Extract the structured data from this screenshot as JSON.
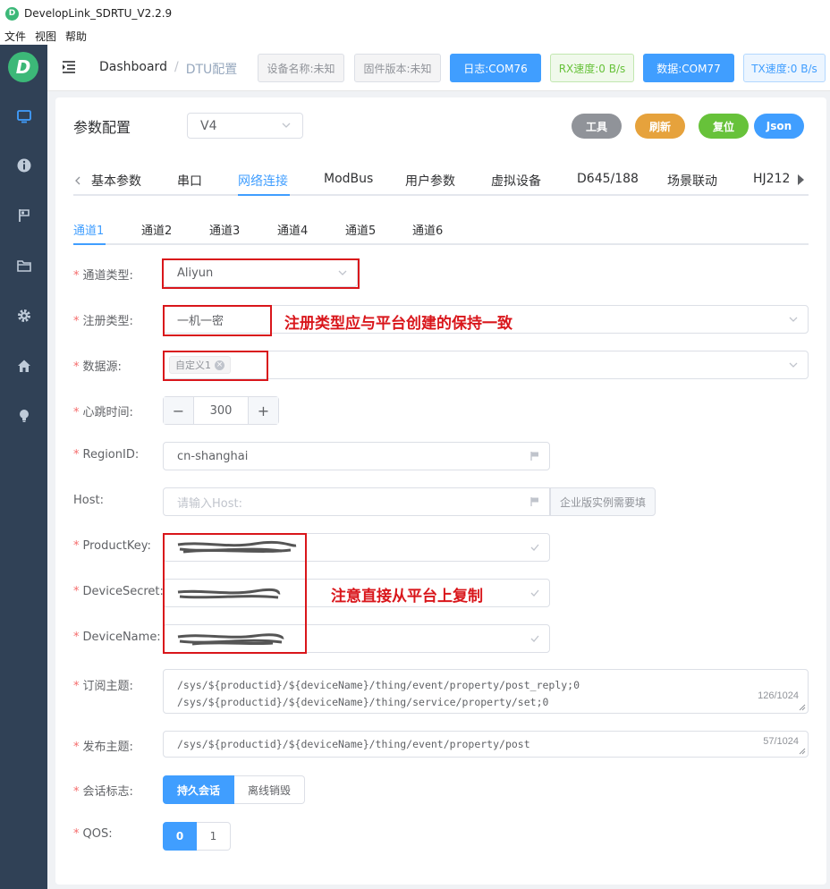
{
  "window": {
    "title": "DevelopLink_SDRTU_V2.2.9",
    "logo_letter": "D"
  },
  "menu": [
    "文件",
    "视图",
    "帮助"
  ],
  "sidebar": {
    "logo_letter": "D",
    "items": [
      {
        "name": "monitor-icon"
      },
      {
        "name": "info-icon"
      },
      {
        "name": "flag-icon"
      },
      {
        "name": "folder-icon"
      },
      {
        "name": "gear-icon"
      },
      {
        "name": "home-icon"
      },
      {
        "name": "bulb-icon"
      }
    ]
  },
  "header": {
    "breadcrumb_home": "Dashboard",
    "breadcrumb_sep": "/",
    "breadcrumb_current": "DTU配置",
    "buttons": {
      "device_name": "设备名称:未知",
      "firmware": "固件版本:未知",
      "log_port": "日志:COM76",
      "rx_speed": "RX速度:0 B/s",
      "data_port": "数据:COM77",
      "tx_speed": "TX速度:0 B/s"
    }
  },
  "card": {
    "title": "参数配置",
    "version_select": "V4",
    "actions": {
      "tool": "工具",
      "refresh": "刷新",
      "reset": "复位",
      "json": "Json"
    }
  },
  "tabs_main": [
    "基本参数",
    "串口",
    "网络连接",
    "ModBus",
    "用户参数",
    "虚拟设备",
    "D645/188",
    "场景联动",
    "HJ212"
  ],
  "tabs_main_active": "网络连接",
  "tabs_channel": [
    "通道1",
    "通道2",
    "通道3",
    "通道4",
    "通道5",
    "通道6"
  ],
  "tabs_channel_active": "通道1",
  "form": {
    "channel_type": {
      "label": "通道类型:",
      "value": "Aliyun"
    },
    "register_type": {
      "label": "注册类型:",
      "value": "一机一密"
    },
    "datasource": {
      "label": "数据源:",
      "tag": "自定义1"
    },
    "heartbeat": {
      "label": "心跳时间:",
      "value": "300",
      "minus": "−",
      "plus": "+"
    },
    "region": {
      "label": "RegionID:",
      "value": "cn-shanghai"
    },
    "host": {
      "label": "Host:",
      "placeholder": "请输入Host:",
      "append": "企业版实例需要填"
    },
    "product_key": {
      "label": "ProductKey:"
    },
    "device_secret": {
      "label": "DeviceSecret:"
    },
    "device_name": {
      "label": "DeviceName:"
    },
    "subscribe": {
      "label": "订阅主题:",
      "line1": "/sys/${productid}/${deviceName}/thing/event/property/post_reply;0",
      "line2": "/sys/${productid}/${deviceName}/thing/service/property/set;0",
      "count": "126/1024"
    },
    "publish": {
      "label": "发布主题:",
      "value": "/sys/${productid}/${deviceName}/thing/event/property/post",
      "count": "57/1024"
    },
    "session": {
      "label": "会话标志:",
      "opt1": "持久会话",
      "opt2": "离线销毁"
    },
    "qos": {
      "label": "QOS:",
      "opt1": "0",
      "opt2": "1"
    }
  },
  "annotations": {
    "register_note": "注册类型应与平台创建的保持一致",
    "copy_note": "注意直接从平台上复制"
  },
  "colors": {
    "primary": "#409eff",
    "sidebar": "#304156",
    "annotation": "#d9161b",
    "tool": "#909399",
    "refresh": "#e6a23c",
    "reset": "#67c23a"
  }
}
